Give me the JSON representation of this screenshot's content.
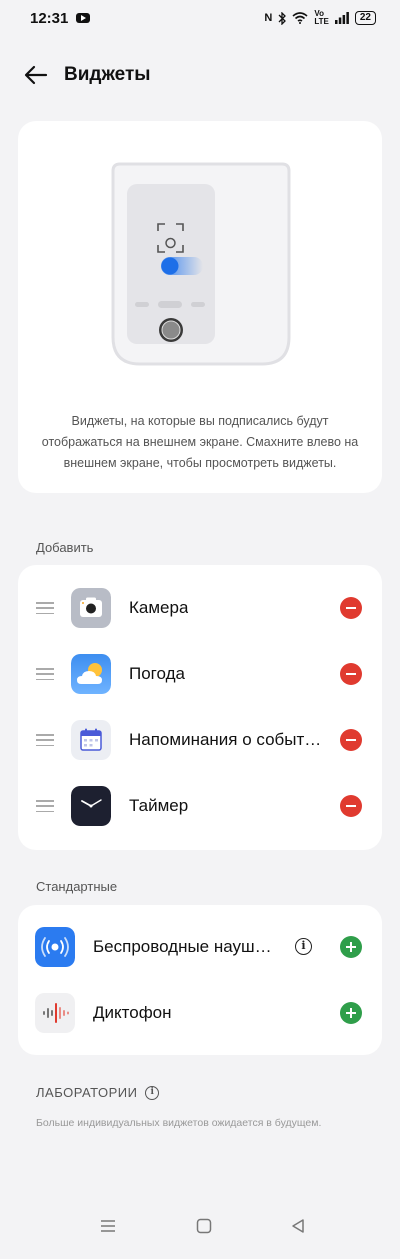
{
  "status": {
    "time": "12:31",
    "battery": "22"
  },
  "header": {
    "title": "Виджеты"
  },
  "hero": {
    "description": "Виджеты, на которые вы подписались будут отображаться на внешнем экране. Смахните влево на внешнем экране, чтобы просмотреть виджеты."
  },
  "add_section": {
    "label": "Добавить",
    "items": [
      {
        "label": "Камера",
        "icon": "camera-app-icon"
      },
      {
        "label": "Погода",
        "icon": "weather-app-icon"
      },
      {
        "label": "Напоминания о событиях",
        "icon": "calendar-app-icon"
      },
      {
        "label": "Таймер",
        "icon": "clock-app-icon"
      }
    ]
  },
  "standard_section": {
    "label": "Стандартные",
    "items": [
      {
        "label": "Беспроводные наушники",
        "icon": "wireless-headphones-icon"
      },
      {
        "label": "Диктофон",
        "icon": "recorder-app-icon"
      }
    ]
  },
  "lab": {
    "label": "ЛАБОРАТОРИИ",
    "description": "Больше индивидуальных виджетов ожидается в будущем."
  },
  "colors": {
    "remove": "#e03a2f",
    "add": "#2f9e4a",
    "accent": "#2b7bf0"
  }
}
